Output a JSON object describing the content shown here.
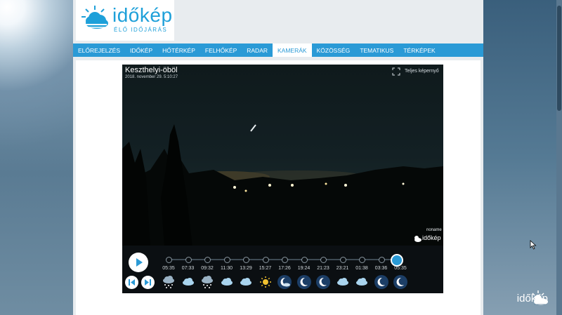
{
  "logo": {
    "text": "időkép",
    "subtitle": "ÉLŐ IDŐJÁRÁS"
  },
  "nav": {
    "items": [
      {
        "label": "ELŐREJELZÉS",
        "active": false
      },
      {
        "label": "IDŐKÉP",
        "active": false
      },
      {
        "label": "HŐTÉRKÉP",
        "active": false
      },
      {
        "label": "FELHŐKÉP",
        "active": false
      },
      {
        "label": "RADAR",
        "active": false
      },
      {
        "label": "KAMERÁK",
        "active": true
      },
      {
        "label": "KÖZÖSSÉG",
        "active": false
      },
      {
        "label": "TEMATIKUS",
        "active": false
      },
      {
        "label": "TÉRKÉPEK",
        "active": false
      }
    ]
  },
  "camera": {
    "title": "Keszthelyi-öböl",
    "datetime": "2018. november 29. 5:10:27",
    "fullscreen_label": "Teljes képernyő",
    "credit": "noname",
    "overlay_logo": "időkép"
  },
  "timeline": {
    "times": [
      "05:35",
      "07:33",
      "09:32",
      "11:30",
      "13:29",
      "15:27",
      "17:26",
      "19:24",
      "21:23",
      "23:21",
      "01:38",
      "03:36",
      "05:35"
    ],
    "icons": [
      "snow-cloud-icon",
      "cloud-icon",
      "snow-cloud-icon",
      "cloud-icon",
      "cloud-icon",
      "sun-icon",
      "night-cloud-icon",
      "moon-icon",
      "moon-icon",
      "cloud-icon",
      "cloud-icon",
      "moon-icon",
      "moon-icon"
    ],
    "current_index": 12
  },
  "watermark": {
    "text": "időkép"
  },
  "colors": {
    "accent": "#2a9ad6",
    "nav_bg": "#2a9ad6",
    "thumb": "#2a9ad6"
  }
}
